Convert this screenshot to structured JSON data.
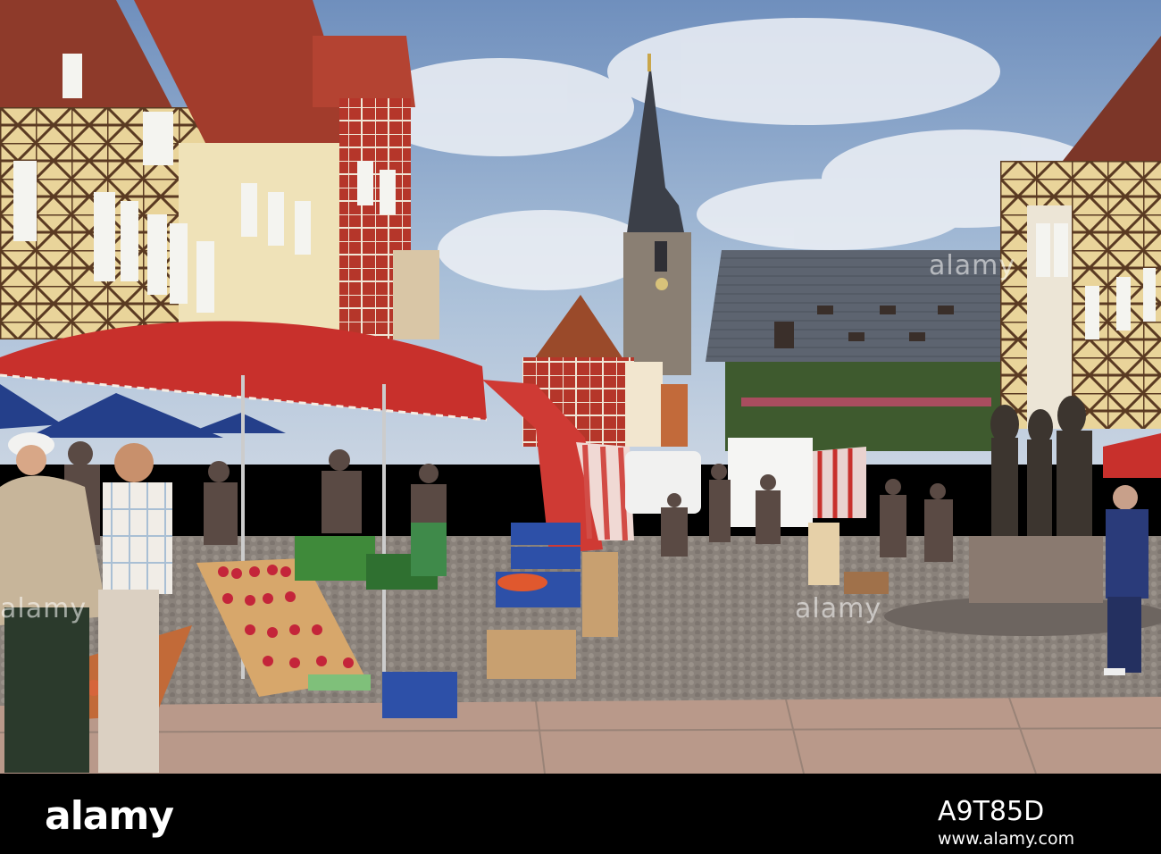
{
  "photo": {
    "subject": "market-square-with-stalls-half-timbered-houses-church-tower-town-hall-fountain"
  },
  "watermark": {
    "text": "alamy"
  },
  "footer": {
    "logo": "alamy",
    "image_id": "A9T85D",
    "url": "www.alamy.com"
  },
  "colors": {
    "sky": "#8aa6c8",
    "awning_red": "#c8302c",
    "cobblestone": "#8c8278",
    "footer_bg": "#000000"
  }
}
